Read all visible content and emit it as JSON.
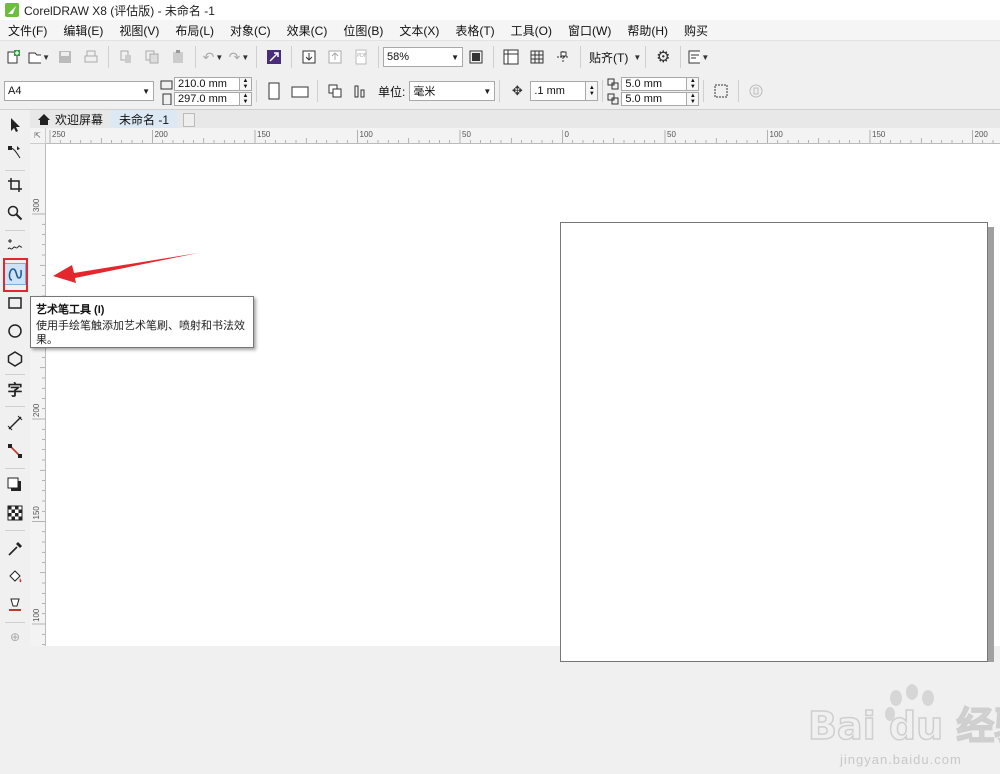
{
  "window": {
    "title": "CorelDRAW X8 (评估版) - 未命名 -1"
  },
  "menu": [
    "文件(F)",
    "编辑(E)",
    "视图(V)",
    "布局(L)",
    "对象(C)",
    "效果(C)",
    "位图(B)",
    "文本(X)",
    "表格(T)",
    "工具(O)",
    "窗口(W)",
    "帮助(H)",
    "购买"
  ],
  "toolbar": {
    "zoom": "58%",
    "snap_label": "贴齐(T)"
  },
  "property_bar": {
    "page_size": "A4",
    "width": "210.0 mm",
    "height": "297.0 mm",
    "units_label": "单位:",
    "units_value": "毫米",
    "nudge": ".1 mm",
    "dup_x": "5.0 mm",
    "dup_y": "5.0 mm"
  },
  "tabs": {
    "welcome": "欢迎屏幕",
    "document": "未命名 -1"
  },
  "rulers": {
    "horizontal": [
      "250",
      "200",
      "150",
      "100",
      "50",
      "0",
      "50",
      "100",
      "150",
      "200"
    ],
    "vertical": [
      "300",
      "250",
      "200",
      "150",
      "100"
    ]
  },
  "tooltip": {
    "title": "艺术笔工具 (I)",
    "body": "使用手绘笔触添加艺术笔刷、喷射和书法效果。"
  },
  "watermark": {
    "logo": "Bai du 经验",
    "sub": "jingyan.baidu.com"
  },
  "colors": {
    "highlight": "#e3272c",
    "arrow": "#e3272c",
    "active_tab": "#dce9f5"
  }
}
